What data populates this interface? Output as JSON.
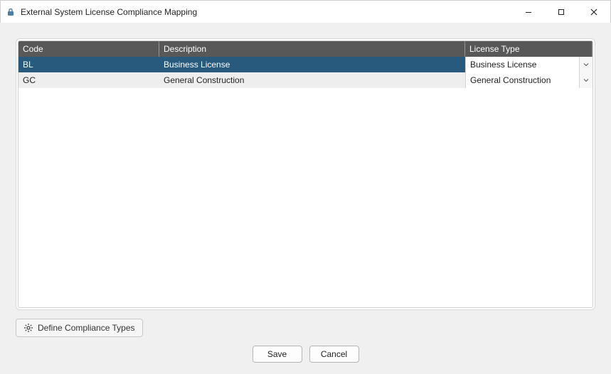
{
  "window": {
    "title": "External System License Compliance Mapping"
  },
  "grid": {
    "columns": {
      "code": {
        "header": "Code"
      },
      "description": {
        "header": "Description"
      },
      "licenseType": {
        "header": "License Type"
      }
    },
    "rows": [
      {
        "code": "BL",
        "description": "Business License",
        "licenseType": "Business License",
        "selected": true
      },
      {
        "code": "GC",
        "description": "General Construction",
        "licenseType": "General Construction",
        "selected": false
      }
    ]
  },
  "buttons": {
    "defineCompliance": "Define Compliance Types",
    "save": "Save",
    "cancel": "Cancel"
  }
}
